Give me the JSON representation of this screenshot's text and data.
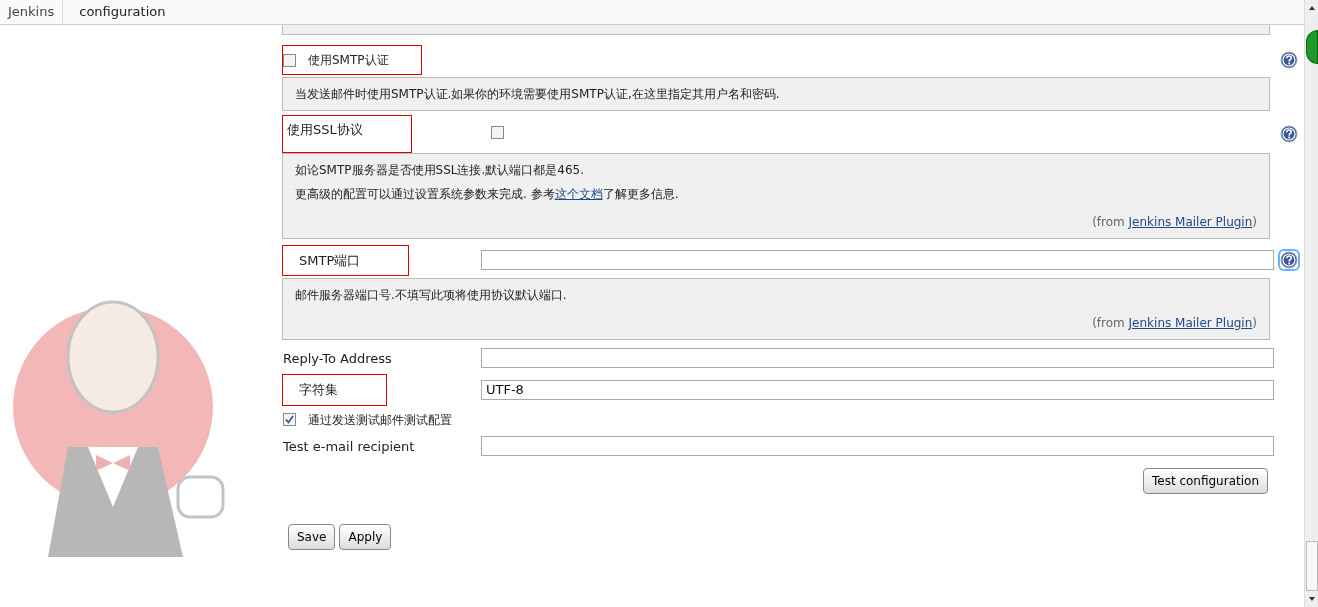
{
  "breadcrumbs": [
    {
      "label": "Jenkins"
    },
    {
      "label": "configuration"
    }
  ],
  "fields": [
    {
      "kind": "checkbox",
      "label": "使用SMTP认证",
      "checked": false,
      "highlighted": true,
      "help_icon": true,
      "help_focused": false,
      "help": {
        "lines": [
          {
            "text": "当发送邮件时使用SMTP认证.如果你的环境需要使用SMTP认证,在这里指定其用户名和密码."
          }
        ]
      }
    },
    {
      "kind": "toggle",
      "label": "使用SSL协议",
      "checked": false,
      "highlighted": true,
      "help_icon": true,
      "help_focused": false,
      "help": {
        "lines": [
          {
            "text": "如论SMTP服务器是否使用SSL连接.默认端口都是465."
          },
          {
            "text": "更高级的配置可以通过设置系统参数来完成. 参考",
            "link": "这个文档",
            "after": "了解更多信息."
          }
        ],
        "from": {
          "prefix": "(from ",
          "link": "Jenkins Mailer Plugin",
          "suffix": ")"
        }
      }
    },
    {
      "kind": "text",
      "label": "SMTP端口",
      "highlighted": true,
      "help_icon": true,
      "help_focused": true,
      "help": {
        "lines": [
          {
            "text": "邮件服务器端口号.不填写此项将使用协议默认端口."
          }
        ],
        "from": {
          "prefix": "(from ",
          "link": "Jenkins Mailer Plugin",
          "suffix": ")"
        }
      }
    },
    {
      "kind": "text",
      "label": "Reply-To Address",
      "highlighted": false
    },
    {
      "kind": "text",
      "label": "字符集",
      "value": "UTF-8",
      "highlighted": true
    },
    {
      "kind": "checkbox",
      "label": "通过发送测试邮件测试配置",
      "checked": true,
      "highlighted": false
    },
    {
      "kind": "text",
      "label": "Test e-mail recipient",
      "highlighted": false
    }
  ],
  "test_button": "Test configuration",
  "buttons": [
    {
      "label": "Save"
    },
    {
      "label": "Apply"
    }
  ]
}
